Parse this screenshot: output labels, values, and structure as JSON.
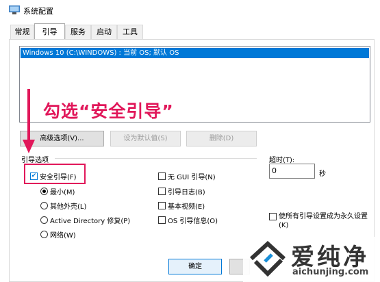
{
  "window": {
    "title": "系统配置"
  },
  "tabs": [
    {
      "label": "常规"
    },
    {
      "label": "引导"
    },
    {
      "label": "服务"
    },
    {
      "label": "启动"
    },
    {
      "label": "工具"
    }
  ],
  "os_list": {
    "entries": [
      "Windows 10 (C:\\WINDOWS) : 当前 OS; 默认 OS"
    ]
  },
  "annotation": {
    "text": "勾选“安全引导”",
    "color": "#e1175a"
  },
  "buttons": {
    "advanced": "高级选项(V)...",
    "set_default": "设为默认值(S)",
    "delete": "删除(D)",
    "ok": "确定"
  },
  "boot_options": {
    "group_label": "引导选项",
    "safe_boot": {
      "label": "安全引导(F)",
      "checked": true
    },
    "radios": [
      {
        "label": "最小(M)",
        "selected": true
      },
      {
        "label": "其他外壳(L)",
        "selected": false
      },
      {
        "label": "Active Directory 修复(P)",
        "selected": false
      },
      {
        "label": "网络(W)",
        "selected": false
      }
    ],
    "checkboxes": [
      {
        "label": "无 GUI 引导(N)",
        "checked": false
      },
      {
        "label": "引导日志(B)",
        "checked": false
      },
      {
        "label": "基本视频(E)",
        "checked": false
      },
      {
        "label": "OS 引导信息(O)",
        "checked": false
      }
    ]
  },
  "timeout": {
    "label": "超时(T):",
    "value": "0",
    "unit": "秒"
  },
  "permanent": {
    "label_line1": "使所有引导设置成为永久设置",
    "label_line2": "(K)",
    "checked": false
  },
  "watermark": {
    "title": "爱纯净",
    "url": "aichunjing.com"
  },
  "colors": {
    "accent": "#0078d7",
    "annotation": "#e1175a"
  }
}
